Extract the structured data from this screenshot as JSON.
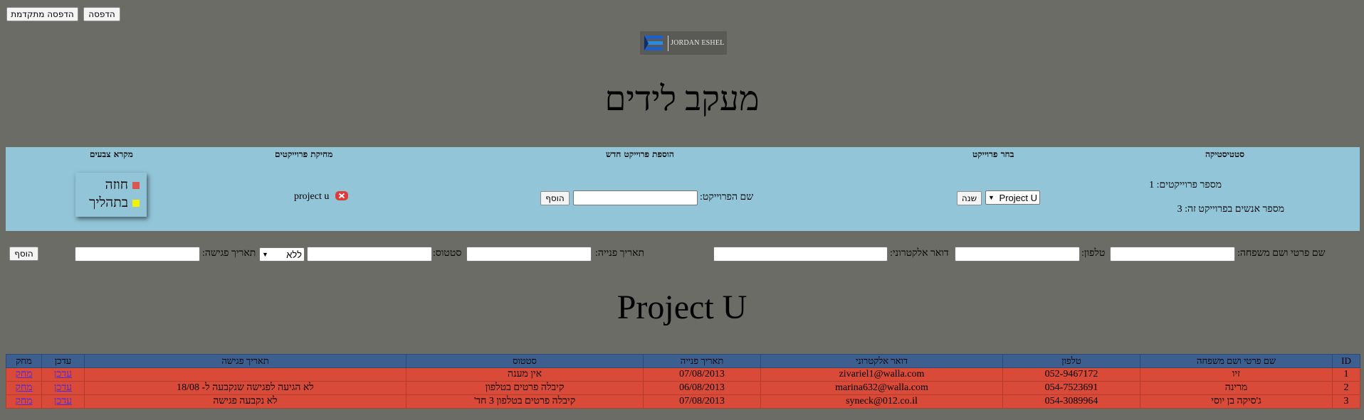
{
  "toolbar": {
    "advanced_print_label": "הדפסה מתקדמת",
    "print_label": "הדפסה"
  },
  "logo": {
    "text": "JORDAN ESHEL"
  },
  "page_title": "מעקב לידים",
  "panel": {
    "statistics": {
      "heading": "סטטיסטיקה",
      "project_count_label": "מספר פרוייקטים:",
      "project_count": "1",
      "people_count_label": "מספר אנשים בפרוייקט זה:",
      "people_count": "3"
    },
    "choose_project": {
      "heading": "בחר פרוייקט",
      "selected": "Project U",
      "change_label": "שנה"
    },
    "add_project": {
      "heading": "הוספת פרוייקט חדש",
      "name_label": "שם הפרוייקט:",
      "name_value": "",
      "add_label": "הוסף"
    },
    "delete_projects": {
      "heading": "מחיקת פרוייקטים",
      "items": [
        "project u"
      ]
    },
    "legend": {
      "heading": "מקרא צבעים",
      "items": [
        {
          "label": "חוזה",
          "color": "#d9574d"
        },
        {
          "label": "בתהליך",
          "color": "#f2f207"
        }
      ]
    }
  },
  "add_lead_form": {
    "name_label": "שם פרטי ושם משפחה:",
    "phone_label": "טלפון:",
    "email_label": "דואר אלקטרוני:",
    "contact_date_label": "תאריך פנייה:",
    "status_label": "סטטוס:",
    "meeting_select": "ללא",
    "meeting_date_label": "תאריך פגישה:",
    "add_label": "הוסף"
  },
  "project_heading": "Project U",
  "table": {
    "headers": [
      "ID",
      "שם פרטי ושם משפחה",
      "טלפון",
      "דואר אלקטרוני",
      "תאריך פנייה",
      "סטטוס",
      "תאריך פגישה",
      "עדכן",
      "מחק"
    ],
    "rows": [
      {
        "id": "1",
        "name": "זיו",
        "phone": "052-9467172",
        "email": "zivariel1@walla.com",
        "date": "07/08/2013",
        "status": "אין מענה",
        "meeting": "",
        "update": "עדכן",
        "delete": "מחק"
      },
      {
        "id": "2",
        "name": "מרינה",
        "phone": "054-7523691",
        "email": "marina632@walla.com",
        "date": "06/08/2013",
        "status": "קיבלה פרטים בטלפון",
        "meeting": "לא הגיעה לפגישה שנקבעה ל- 18/08",
        "update": "עדכן",
        "delete": "מחק"
      },
      {
        "id": "3",
        "name": "ג'סיקה בן יוסי",
        "phone": "054-3089964",
        "email": "syneck@012.co.il",
        "date": "07/08/2013",
        "status": "קיבלה פרטים בטלפון 3 חד'",
        "meeting": "לא נקבעה פגישה",
        "update": "עדכן",
        "delete": "מחק"
      }
    ]
  },
  "colors": {
    "background": "#6b6c66",
    "panel": "#92c5d8",
    "table_header": "#3d5f8f",
    "row_contract": "#d94a38"
  }
}
